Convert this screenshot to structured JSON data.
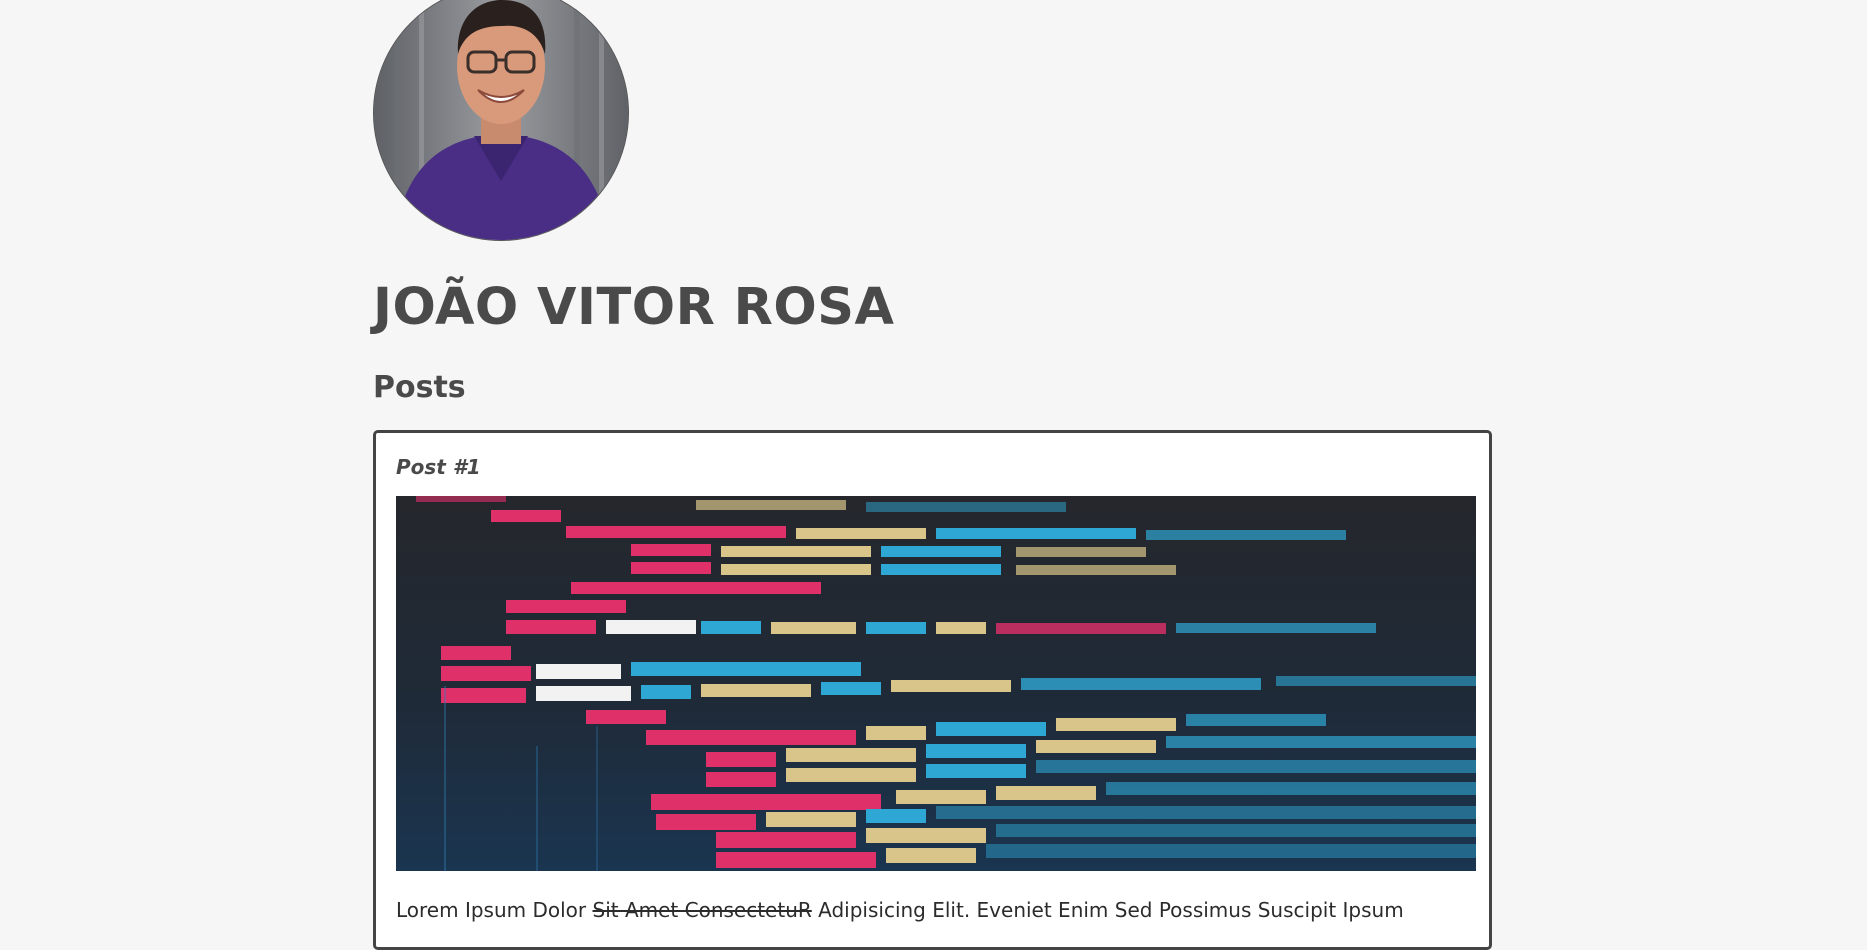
{
  "profile": {
    "name": "JOÃO VITOR ROSA",
    "avatar_alt": "profile-photo"
  },
  "posts_section": {
    "title": "Posts"
  },
  "posts": [
    {
      "title": "Post #1",
      "image": "code-screenshot",
      "body_start": "Lorem Ipsum Dolor ",
      "body_strike": "Sit Amet ConsectetuR",
      "body_end": " Adipisicing Elit. Eveniet Enim Sed Possimus Suscipit Ipsum"
    }
  ]
}
